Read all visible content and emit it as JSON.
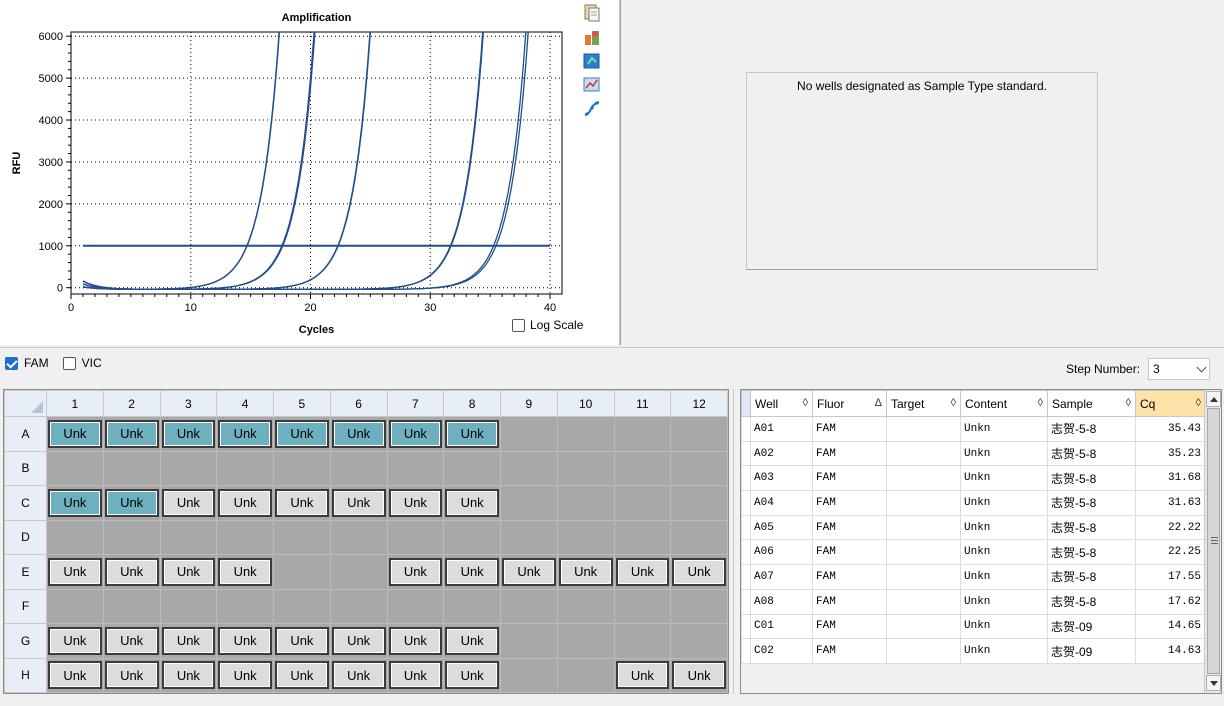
{
  "chart": {
    "log_scale_label": "Log Scale",
    "log_scale_checked": false
  },
  "chart_data": {
    "type": "line",
    "title": "Amplification",
    "xlabel": "Cycles",
    "ylabel": "RFU",
    "xlim": [
      0,
      41
    ],
    "ylim": [
      -150,
      6100
    ],
    "xticks": [
      0,
      10,
      20,
      30,
      40
    ],
    "yticks": [
      0,
      1000,
      2000,
      3000,
      4000,
      5000,
      6000
    ],
    "grid": true,
    "threshold": 1000,
    "line_color": "#1f4e8c",
    "series": [
      {
        "cq": 14.63
      },
      {
        "cq": 14.65
      },
      {
        "cq": 17.55
      },
      {
        "cq": 17.62
      },
      {
        "cq": 22.22
      },
      {
        "cq": 22.25
      },
      {
        "cq": 31.63
      },
      {
        "cq": 31.68
      },
      {
        "cq": 35.23
      },
      {
        "cq": 35.43
      }
    ]
  },
  "tools": [
    {
      "name": "copy-icon"
    },
    {
      "name": "export-icon"
    },
    {
      "name": "refresh-icon"
    },
    {
      "name": "chart-settings-icon"
    },
    {
      "name": "curve-fit-icon"
    }
  ],
  "standard_curve": {
    "message": "No wells designated as Sample Type standard."
  },
  "fluors": [
    {
      "label": "FAM",
      "checked": true
    },
    {
      "label": "VIC",
      "checked": false
    }
  ],
  "step": {
    "label": "Step Number:",
    "value": "3"
  },
  "plate": {
    "columns": [
      "1",
      "2",
      "3",
      "4",
      "5",
      "6",
      "7",
      "8",
      "9",
      "10",
      "11",
      "12"
    ],
    "rows": [
      {
        "label": "A",
        "wells": [
          "sel",
          "sel",
          "sel",
          "sel",
          "sel",
          "sel",
          "sel",
          "sel",
          "",
          "",
          "",
          ""
        ]
      },
      {
        "label": "B",
        "wells": [
          "",
          "",
          "",
          "",
          "",
          "",
          "",
          "",
          "",
          "",
          "",
          ""
        ]
      },
      {
        "label": "C",
        "wells": [
          "sel",
          "sel",
          "uns",
          "uns",
          "uns",
          "uns",
          "uns",
          "uns",
          "",
          "",
          "",
          ""
        ]
      },
      {
        "label": "D",
        "wells": [
          "",
          "",
          "",
          "",
          "",
          "",
          "",
          "",
          "",
          "",
          "",
          ""
        ]
      },
      {
        "label": "E",
        "wells": [
          "uns",
          "uns",
          "uns",
          "uns",
          "",
          "",
          "uns",
          "uns",
          "uns",
          "uns",
          "uns",
          "uns"
        ]
      },
      {
        "label": "F",
        "wells": [
          "",
          "",
          "",
          "",
          "",
          "",
          "",
          "",
          "",
          "",
          "",
          ""
        ]
      },
      {
        "label": "G",
        "wells": [
          "uns",
          "uns",
          "uns",
          "uns",
          "uns",
          "uns",
          "uns",
          "uns",
          "",
          "",
          "",
          ""
        ]
      },
      {
        "label": "H",
        "wells": [
          "uns",
          "uns",
          "uns",
          "uns",
          "uns",
          "uns",
          "uns",
          "uns",
          "",
          "",
          "uns",
          "uns"
        ]
      }
    ],
    "well_label": "Unk"
  },
  "results": {
    "columns": [
      {
        "label": "Well",
        "sort": "◊"
      },
      {
        "label": "Fluor",
        "sort": "Δ"
      },
      {
        "label": "Target",
        "sort": "◊"
      },
      {
        "label": "Content",
        "sort": "◊"
      },
      {
        "label": "Sample",
        "sort": "◊"
      },
      {
        "label": "Cq",
        "sort": "◊"
      }
    ],
    "rows": [
      {
        "well": "A01",
        "fluor": "FAM",
        "target": "",
        "content": "Unkn",
        "sample": "志贺-5-8",
        "cq": "35.43"
      },
      {
        "well": "A02",
        "fluor": "FAM",
        "target": "",
        "content": "Unkn",
        "sample": "志贺-5-8",
        "cq": "35.23"
      },
      {
        "well": "A03",
        "fluor": "FAM",
        "target": "",
        "content": "Unkn",
        "sample": "志贺-5-8",
        "cq": "31.68"
      },
      {
        "well": "A04",
        "fluor": "FAM",
        "target": "",
        "content": "Unkn",
        "sample": "志贺-5-8",
        "cq": "31.63"
      },
      {
        "well": "A05",
        "fluor": "FAM",
        "target": "",
        "content": "Unkn",
        "sample": "志贺-5-8",
        "cq": "22.22"
      },
      {
        "well": "A06",
        "fluor": "FAM",
        "target": "",
        "content": "Unkn",
        "sample": "志贺-5-8",
        "cq": "22.25"
      },
      {
        "well": "A07",
        "fluor": "FAM",
        "target": "",
        "content": "Unkn",
        "sample": "志贺-5-8",
        "cq": "17.55"
      },
      {
        "well": "A08",
        "fluor": "FAM",
        "target": "",
        "content": "Unkn",
        "sample": "志贺-5-8",
        "cq": "17.62"
      },
      {
        "well": "C01",
        "fluor": "FAM",
        "target": "",
        "content": "Unkn",
        "sample": "志贺-09",
        "cq": "14.65"
      },
      {
        "well": "C02",
        "fluor": "FAM",
        "target": "",
        "content": "Unkn",
        "sample": "志贺-09",
        "cq": "14.63"
      }
    ]
  },
  "colors": {
    "selected_well": "#6db0bf",
    "unselected_well": "#dcdcdc",
    "sorted_header": "#fde3a7",
    "curve": "#1f4e8c",
    "check_accent": "#1f6fd1"
  }
}
